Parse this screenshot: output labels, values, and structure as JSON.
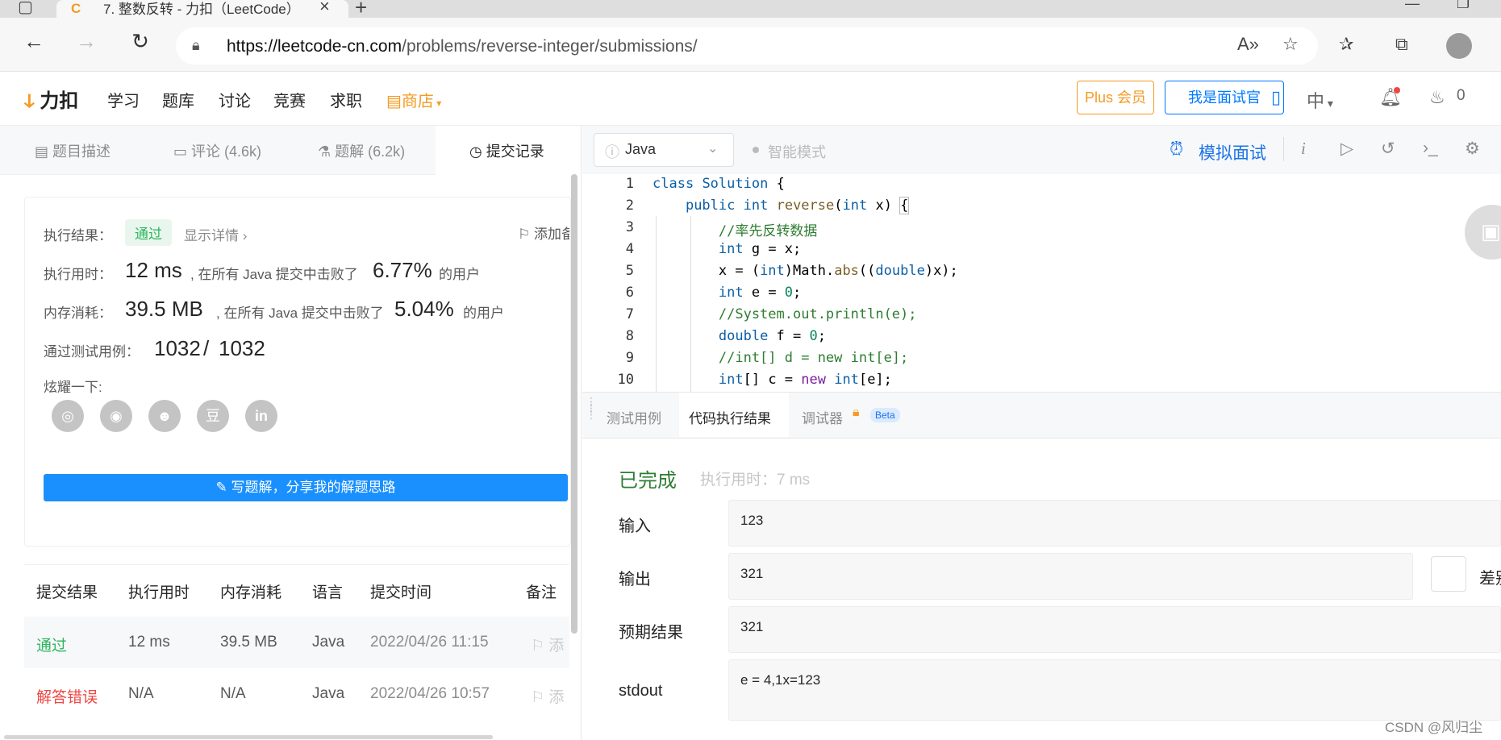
{
  "browser": {
    "tab_title": "7. 整数反转 - 力扣（LeetCode）",
    "tab_icon": "leetcode-logo-icon",
    "url_domain": "https://leetcode-cn.com",
    "url_path": "/problems/reverse-integer/submissions/"
  },
  "header": {
    "logo_text": "力扣",
    "nav": [
      "学习",
      "题库",
      "讨论",
      "竞赛",
      "求职"
    ],
    "shop": "商店",
    "plus": "Plus 会员",
    "interviewer": "我是面试官",
    "lang": "中",
    "fire_count": "0"
  },
  "left_tabs": {
    "desc": "题目描述",
    "comments": "评论 (4.6k)",
    "solutions": "题解 (6.2k)",
    "submissions": "提交记录"
  },
  "result_card": {
    "exec_result_label": "执行结果：",
    "status": "通过",
    "show_detail": "显示详情",
    "add_note": "添加备注",
    "time_label": "执行用时：",
    "time_value": "12 ms",
    "time_mid": ", 在所有 Java 提交中击败了",
    "time_pct": "6.77%",
    "time_tail": "的用户",
    "mem_label": "内存消耗：",
    "mem_value": "39.5 MB",
    "mem_mid": ", 在所有 Java 提交中击败了",
    "mem_pct": "5.04%",
    "mem_tail": "的用户",
    "cases_label": "通过测试用例：",
    "cases_passed": "1032",
    "cases_sep": "/",
    "cases_total": "1032",
    "share_label": "炫耀一下:",
    "share_icons": [
      "wechat-icon",
      "weibo-icon",
      "qq-icon",
      "douban-icon",
      "linkedin-icon"
    ],
    "write_btn": "写题解，分享我的解题思路"
  },
  "submissions_table": {
    "headers": [
      "提交结果",
      "执行用时",
      "内存消耗",
      "语言",
      "提交时间",
      "备注"
    ],
    "rows": [
      {
        "result": "通过",
        "time": "12 ms",
        "memory": "39.5 MB",
        "lang": "Java",
        "submitted": "2022/04/26 11:15",
        "note": "添"
      },
      {
        "result": "解答错误",
        "time": "N/A",
        "memory": "N/A",
        "lang": "Java",
        "submitted": "2022/04/26 10:57",
        "note": "添"
      }
    ]
  },
  "toolbar": {
    "language": "Java",
    "smart_mode": "智能模式",
    "mock_interview": "模拟面试"
  },
  "editor": {
    "line_numbers": [
      "1",
      "2",
      "3",
      "4",
      "5",
      "6",
      "7",
      "8",
      "9",
      "10"
    ]
  },
  "console": {
    "tabs": [
      "测试用例",
      "代码执行结果",
      "调试器"
    ],
    "beta": "Beta",
    "status": "已完成",
    "exec_time": "执行用时：7 ms",
    "input_label": "输入",
    "input_value": "123",
    "output_label": "输出",
    "output_value": "321",
    "expected_label": "预期结果",
    "expected_value": "321",
    "stdout_label": "stdout",
    "stdout_value": "e = 4,1x=123",
    "diff_label": "差别"
  },
  "watermark": "CSDN @风归尘",
  "colors": {
    "accent_blue": "#007aff",
    "brand_orange": "#f59a23",
    "success_green": "#2db55d",
    "error_red": "#ef4743"
  }
}
